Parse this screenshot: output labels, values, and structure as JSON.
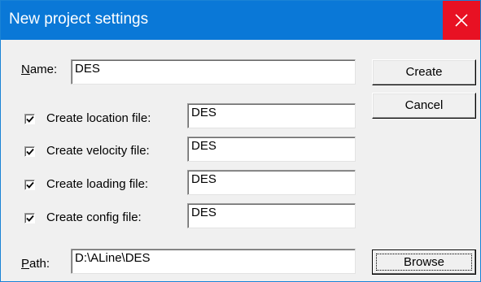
{
  "window": {
    "title": "New project settings",
    "close_glyph": "close-icon"
  },
  "name": {
    "label_mnemonic": "N",
    "label_rest": "ame:",
    "value": "DES"
  },
  "options": [
    {
      "label": "Create location file:",
      "checked": true,
      "value": "DES"
    },
    {
      "label": "Create velocity file:",
      "checked": true,
      "value": "DES"
    },
    {
      "label": "Create loading file:",
      "checked": true,
      "value": "DES"
    },
    {
      "label": "Create config file:",
      "checked": true,
      "value": "DES"
    }
  ],
  "path": {
    "label_mnemonic": "P",
    "label_rest": "ath:",
    "value": "D:\\ALine\\DES"
  },
  "buttons": {
    "create": "Create",
    "cancel": "Cancel",
    "browse": "Browse"
  },
  "colors": {
    "titlebar": "#0a78d7",
    "close": "#e81123",
    "dialog_bg": "#f0f0f0"
  }
}
